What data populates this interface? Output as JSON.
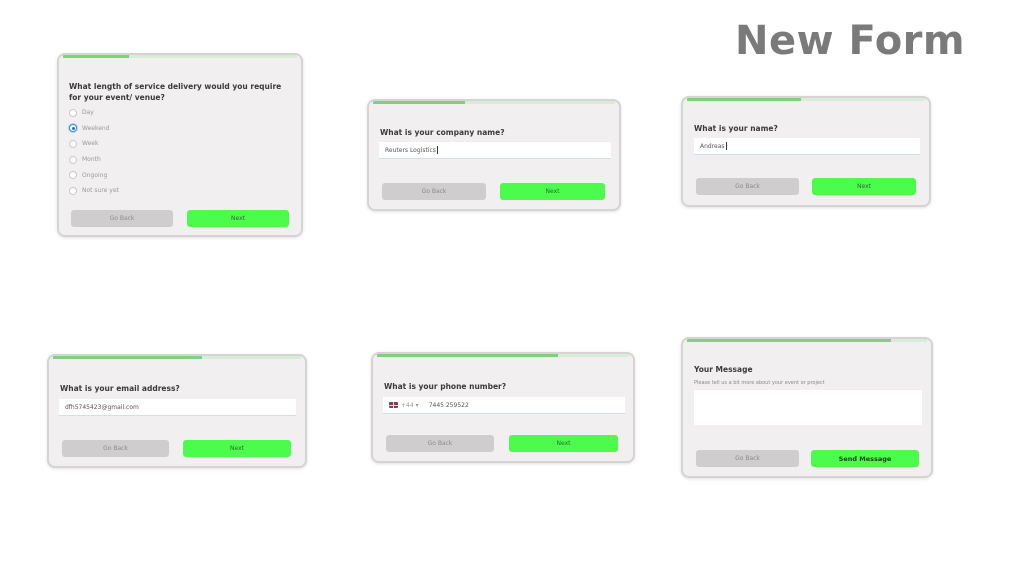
{
  "page": {
    "title": "New Form"
  },
  "colors": {
    "accent_green": "#4cfc4c",
    "progress_green": "#7fd07f",
    "card_bg": "#f1efef",
    "back_button": "#cfcdcd",
    "radio_checked": "#3a8fd8"
  },
  "forms": {
    "service_length": {
      "progress_percent": 28,
      "question": "What length of service delivery would you require for your event/ venue?",
      "options": [
        {
          "label": "Day",
          "checked": false
        },
        {
          "label": "Weekend",
          "checked": true
        },
        {
          "label": "Week",
          "checked": false
        },
        {
          "label": "Month",
          "checked": false
        },
        {
          "label": "Ongoing",
          "checked": false
        },
        {
          "label": "Not sure yet",
          "checked": false
        }
      ],
      "back_label": "Go Back",
      "next_label": "Next"
    },
    "company": {
      "progress_percent": 38,
      "question": "What is your company name?",
      "value": "Reuters Logistics",
      "back_label": "Go Back",
      "next_label": "Next"
    },
    "name": {
      "progress_percent": 48,
      "question": "What is your name?",
      "value": "Andreas",
      "back_label": "Go Back",
      "next_label": "Next"
    },
    "email": {
      "progress_percent": 60,
      "question": "What is your email address?",
      "value": "dfh5745423@gmail.com",
      "back_label": "Go Back",
      "next_label": "Next"
    },
    "phone": {
      "progress_percent": 72,
      "question": "What is your phone number?",
      "country_flag": "uk-flag-icon",
      "country_code": "+44",
      "dropdown_glyph": "▾",
      "value": "7445 259522",
      "back_label": "Go Back",
      "next_label": "Next"
    },
    "message": {
      "progress_percent": 85,
      "question": "Your Message",
      "hint": "Please tell us a bit more about your event or project",
      "value": "",
      "back_label": "Go Back",
      "send_label": "Send Message"
    }
  }
}
